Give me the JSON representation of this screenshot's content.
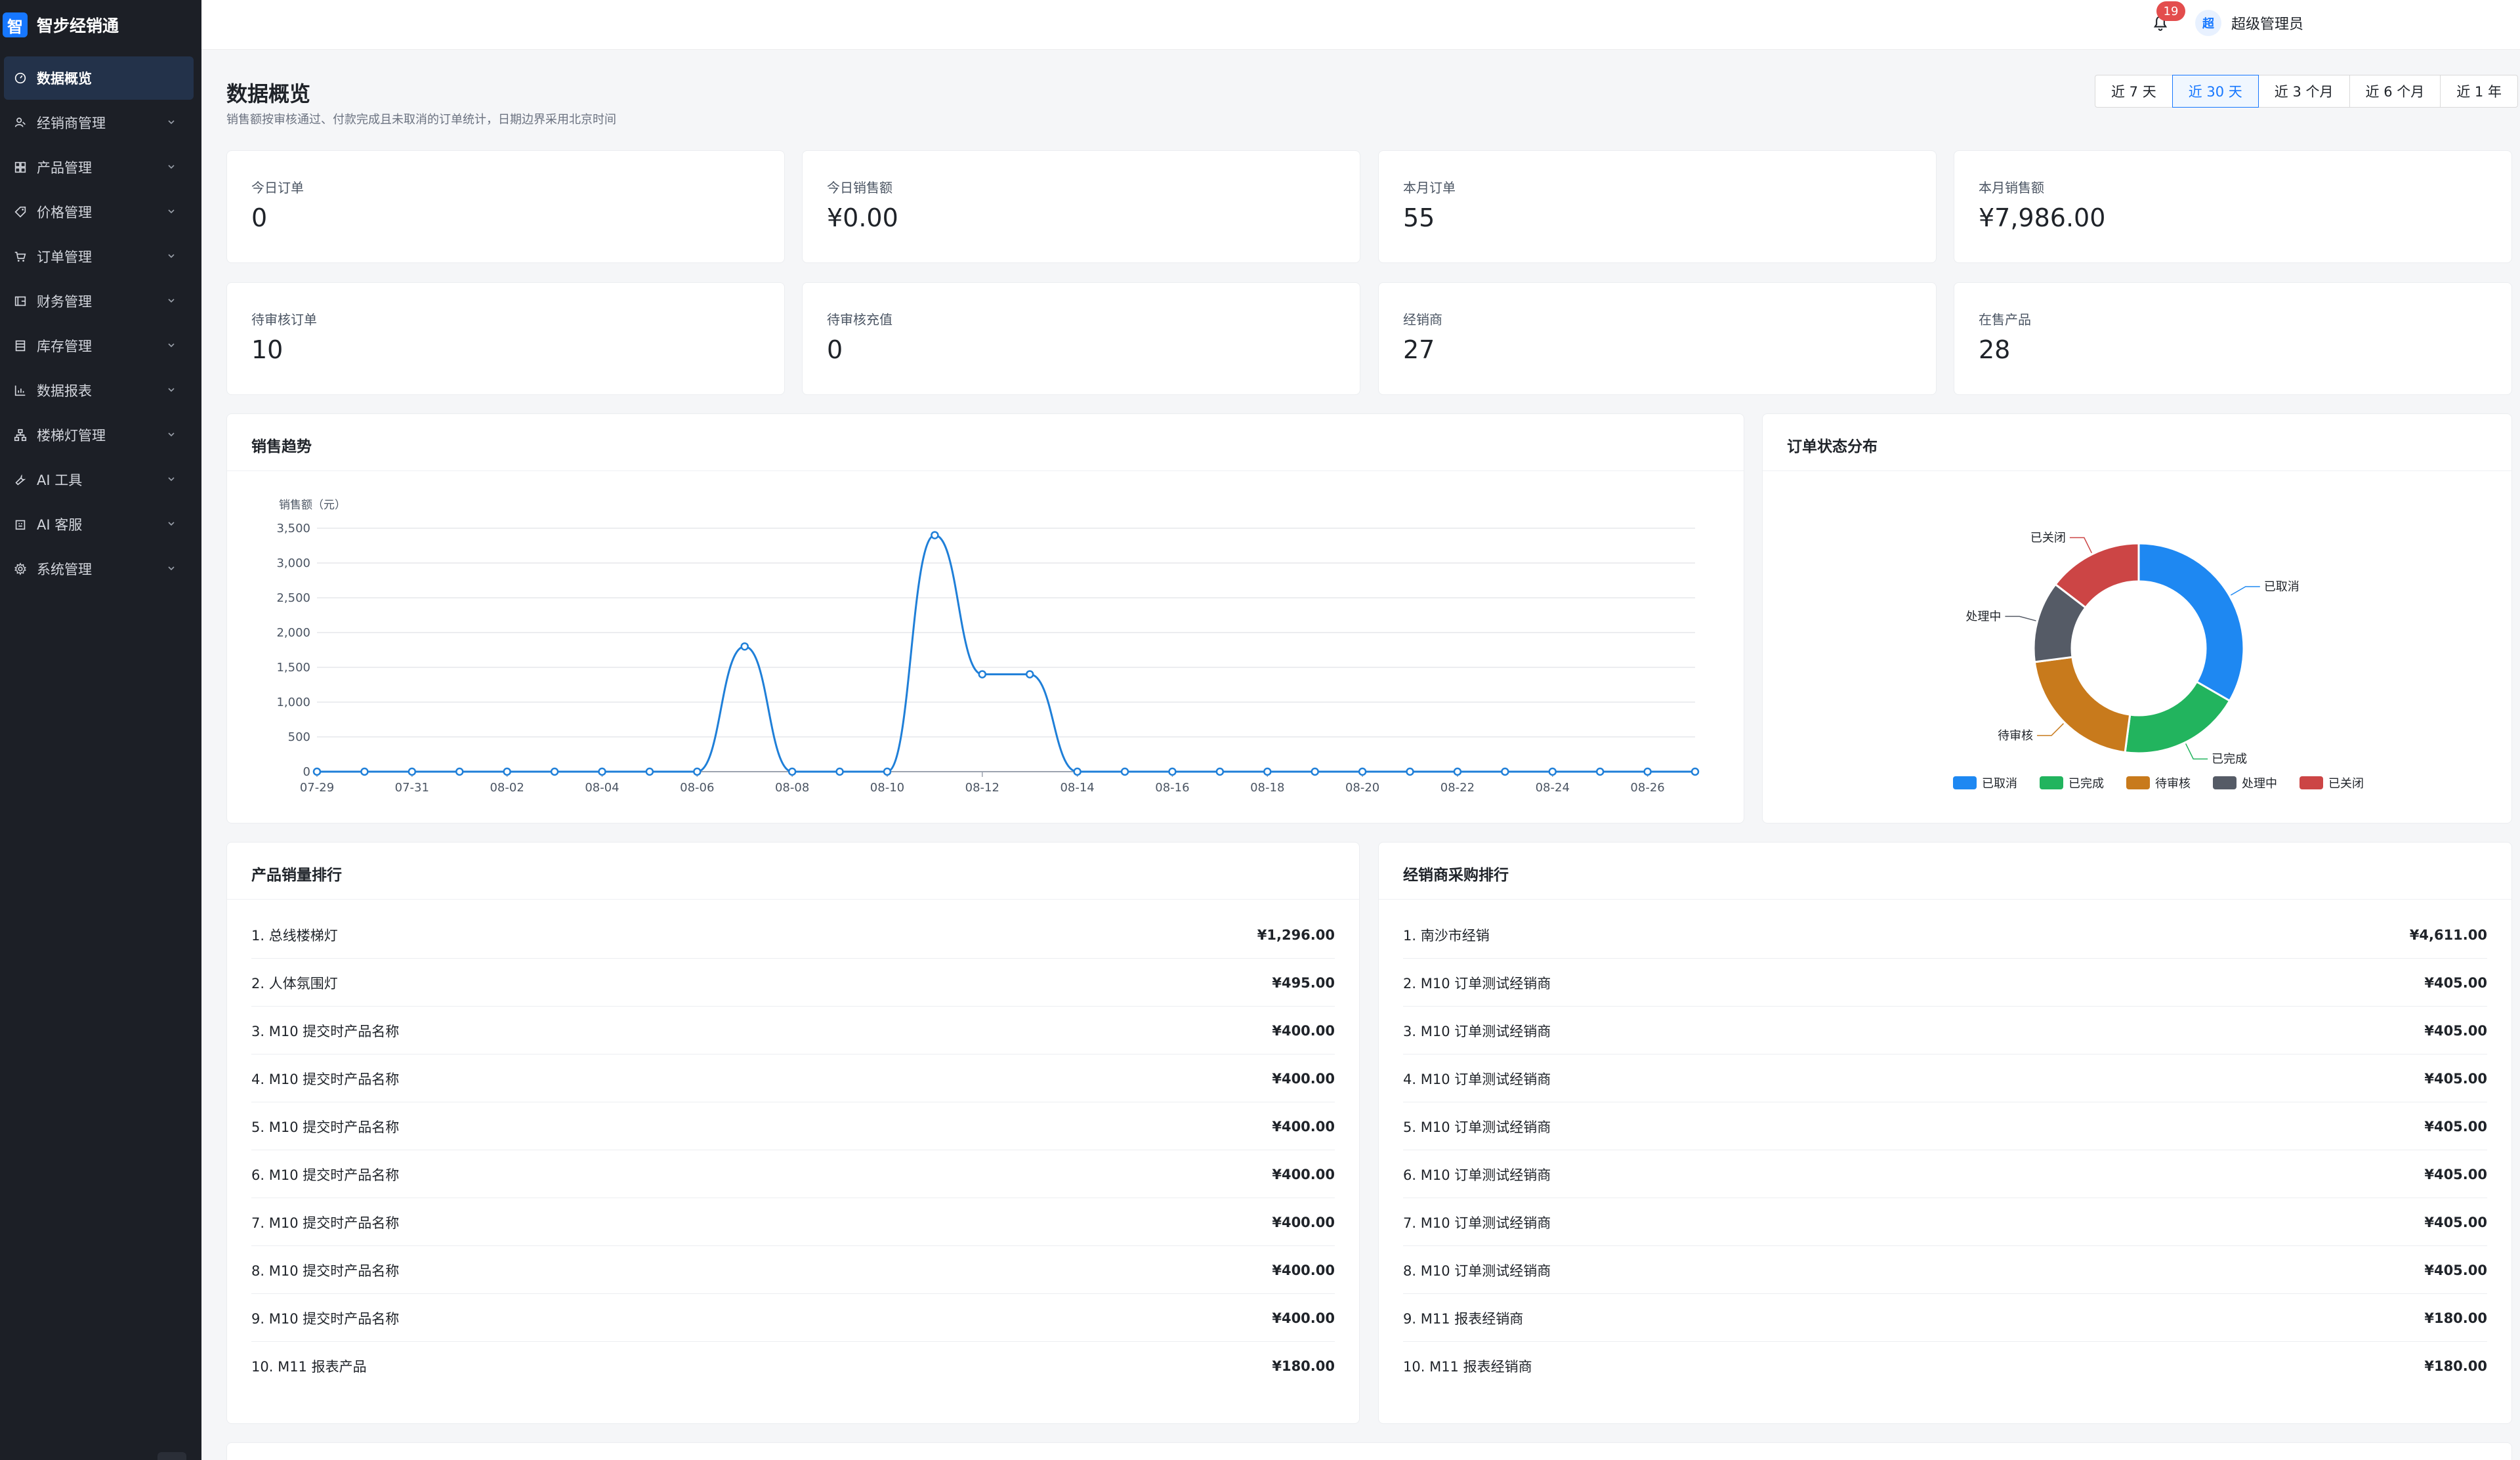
{
  "brand": {
    "logo_char": "智",
    "name": "智步经销通"
  },
  "sidebar": {
    "items": [
      {
        "label": "数据概览",
        "icon": "dashboard-icon",
        "active": true,
        "expandable": false
      },
      {
        "label": "经销商管理",
        "icon": "users-icon",
        "expandable": true
      },
      {
        "label": "产品管理",
        "icon": "grid-icon",
        "expandable": true
      },
      {
        "label": "价格管理",
        "icon": "tag-icon",
        "expandable": true
      },
      {
        "label": "订单管理",
        "icon": "cart-icon",
        "expandable": true
      },
      {
        "label": "财务管理",
        "icon": "wallet-icon",
        "expandable": true
      },
      {
        "label": "库存管理",
        "icon": "inventory-icon",
        "expandable": true
      },
      {
        "label": "数据报表",
        "icon": "bar-chart-icon",
        "expandable": true
      },
      {
        "label": "楼梯灯管理",
        "icon": "network-icon",
        "expandable": true
      },
      {
        "label": "AI 工具",
        "icon": "wrench-icon",
        "expandable": true
      },
      {
        "label": "AI 客服",
        "icon": "robot-icon",
        "expandable": true
      },
      {
        "label": "系统管理",
        "icon": "gear-icon",
        "expandable": true
      }
    ]
  },
  "header": {
    "notification_count": "19",
    "avatar_char": "超",
    "user_name": "超级管理员"
  },
  "page": {
    "title": "数据概览",
    "subtitle": "销售额按审核通过、付款完成且未取消的订单统计，日期边界采用北京时间",
    "ranges": [
      {
        "label": "近 7 天",
        "active": false
      },
      {
        "label": "近 30 天",
        "active": true
      },
      {
        "label": "近 3 个月",
        "active": false
      },
      {
        "label": "近 6 个月",
        "active": false
      },
      {
        "label": "近 1 年",
        "active": false
      }
    ]
  },
  "stats": [
    {
      "label": "今日订单",
      "value": "0"
    },
    {
      "label": "今日销售额",
      "value": "¥0.00"
    },
    {
      "label": "本月订单",
      "value": "55"
    },
    {
      "label": "本月销售额",
      "value": "¥7,986.00"
    },
    {
      "label": "待审核订单",
      "value": "10"
    },
    {
      "label": "待审核充值",
      "value": "0"
    },
    {
      "label": "经销商",
      "value": "27"
    },
    {
      "label": "在售产品",
      "value": "28"
    }
  ],
  "sales_trend": {
    "title": "销售趋势",
    "chart_data": {
      "type": "line",
      "ylabel": "销售额（元）",
      "ylim": [
        0,
        3500
      ],
      "yticks": [
        0,
        500,
        1000,
        1500,
        2000,
        2500,
        3000,
        3500
      ],
      "ytick_labels": [
        "0",
        "500",
        "1,000",
        "1,500",
        "2,000",
        "2,500",
        "3,000",
        "3,500"
      ],
      "x": [
        "07-29",
        "07-30",
        "07-31",
        "08-01",
        "08-02",
        "08-03",
        "08-04",
        "08-05",
        "08-06",
        "08-07",
        "08-08",
        "08-09",
        "08-10",
        "08-11",
        "08-12",
        "08-13",
        "08-14",
        "08-15",
        "08-16",
        "08-17",
        "08-18",
        "08-19",
        "08-20",
        "08-21",
        "08-22",
        "08-23",
        "08-24",
        "08-25",
        "08-26",
        "08-27"
      ],
      "xtick_labels_shown": [
        "07-29",
        "07-31",
        "08-02",
        "08-04",
        "08-06",
        "08-08",
        "08-10",
        "08-12",
        "08-14",
        "08-16",
        "08-18",
        "08-20",
        "08-22",
        "08-24",
        "08-26"
      ],
      "series": [
        {
          "values": [
            0,
            0,
            0,
            0,
            0,
            0,
            0,
            0,
            0,
            1800,
            0,
            0,
            0,
            3400,
            1400,
            1400,
            0,
            0,
            0,
            0,
            0,
            0,
            0,
            0,
            0,
            0,
            0,
            0,
            0,
            0
          ],
          "color": "#1f7fd8"
        }
      ],
      "smooth": true,
      "grid": true
    }
  },
  "order_status": {
    "title": "订单状态分布",
    "chart_data": {
      "type": "pie",
      "donut": true,
      "categories": [
        "已取消",
        "已完成",
        "待审核",
        "处理中",
        "已关闭"
      ],
      "values": [
        16,
        9,
        10,
        6,
        7
      ],
      "colors": [
        "#1e88f2",
        "#22b45e",
        "#c87a1c",
        "#555b66",
        "#cc4545"
      ],
      "legend": "bottom"
    }
  },
  "product_ranking": {
    "title": "产品销量排行",
    "rows": [
      {
        "name": "1. 总线楼梯灯",
        "amount": "¥1,296.00"
      },
      {
        "name": "2. 人体氛围灯",
        "amount": "¥495.00"
      },
      {
        "name": "3. M10 提交时产品名称",
        "amount": "¥400.00"
      },
      {
        "name": "4. M10 提交时产品名称",
        "amount": "¥400.00"
      },
      {
        "name": "5. M10 提交时产品名称",
        "amount": "¥400.00"
      },
      {
        "name": "6. M10 提交时产品名称",
        "amount": "¥400.00"
      },
      {
        "name": "7. M10 提交时产品名称",
        "amount": "¥400.00"
      },
      {
        "name": "8. M10 提交时产品名称",
        "amount": "¥400.00"
      },
      {
        "name": "9. M10 提交时产品名称",
        "amount": "¥400.00"
      },
      {
        "name": "10. M11 报表产品",
        "amount": "¥180.00"
      }
    ]
  },
  "dealer_ranking": {
    "title": "经销商采购排行",
    "rows": [
      {
        "name": "1. 南沙市经销",
        "amount": "¥4,611.00"
      },
      {
        "name": "2. M10 订单测试经销商",
        "amount": "¥405.00"
      },
      {
        "name": "3. M10 订单测试经销商",
        "amount": "¥405.00"
      },
      {
        "name": "4. M10 订单测试经销商",
        "amount": "¥405.00"
      },
      {
        "name": "5. M10 订单测试经销商",
        "amount": "¥405.00"
      },
      {
        "name": "6. M10 订单测试经销商",
        "amount": "¥405.00"
      },
      {
        "name": "7. M10 订单测试经销商",
        "amount": "¥405.00"
      },
      {
        "name": "8. M10 订单测试经销商",
        "amount": "¥405.00"
      },
      {
        "name": "9. M11 报表经销商",
        "amount": "¥180.00"
      },
      {
        "name": "10. M11 报表经销商",
        "amount": "¥180.00"
      }
    ]
  }
}
